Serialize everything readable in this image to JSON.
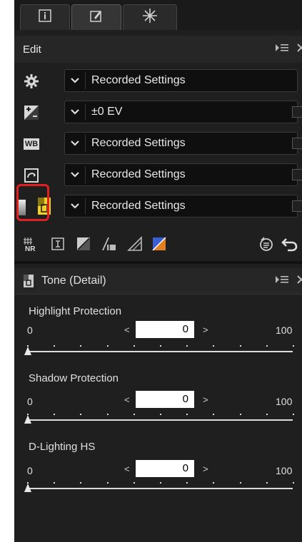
{
  "tabs": [
    {
      "name": "info",
      "icon": "info-icon"
    },
    {
      "name": "edit",
      "icon": "edit-icon"
    },
    {
      "name": "effects",
      "icon": "sparkle-icon"
    }
  ],
  "edit_panel": {
    "title": "Edit",
    "rows": [
      {
        "icon": "gear-icon",
        "value": "Recorded Settings"
      },
      {
        "icon": "exposure-compensation-icon",
        "value": "±0 EV"
      },
      {
        "icon": "white-balance-icon",
        "value": "Recorded Settings"
      },
      {
        "icon": "picture-control-icon",
        "value": "Recorded Settings"
      },
      {
        "icon": "tone-detail-icon",
        "value": "Recorded Settings"
      }
    ],
    "wb_badge": "WB"
  },
  "tools": [
    "noise-reduction-icon",
    "crop-icon",
    "levels-curves-icon",
    "tone-adjust-icon",
    "unsharp-icon",
    "color-balance-icon"
  ],
  "tool_labels": {
    "nr": "NR"
  },
  "tone_panel": {
    "title": "Tone (Detail)",
    "sliders": [
      {
        "label": "Highlight Protection",
        "min": "0",
        "max": "100",
        "value": "0"
      },
      {
        "label": "Shadow Protection",
        "min": "0",
        "max": "100",
        "value": "0"
      },
      {
        "label": "D-Lighting HS",
        "min": "0",
        "max": "100",
        "value": "0"
      }
    ]
  },
  "colors": {
    "panel_bg": "#1f1f1f",
    "highlight": "#e02020",
    "tone_icon": "#f0d020"
  }
}
